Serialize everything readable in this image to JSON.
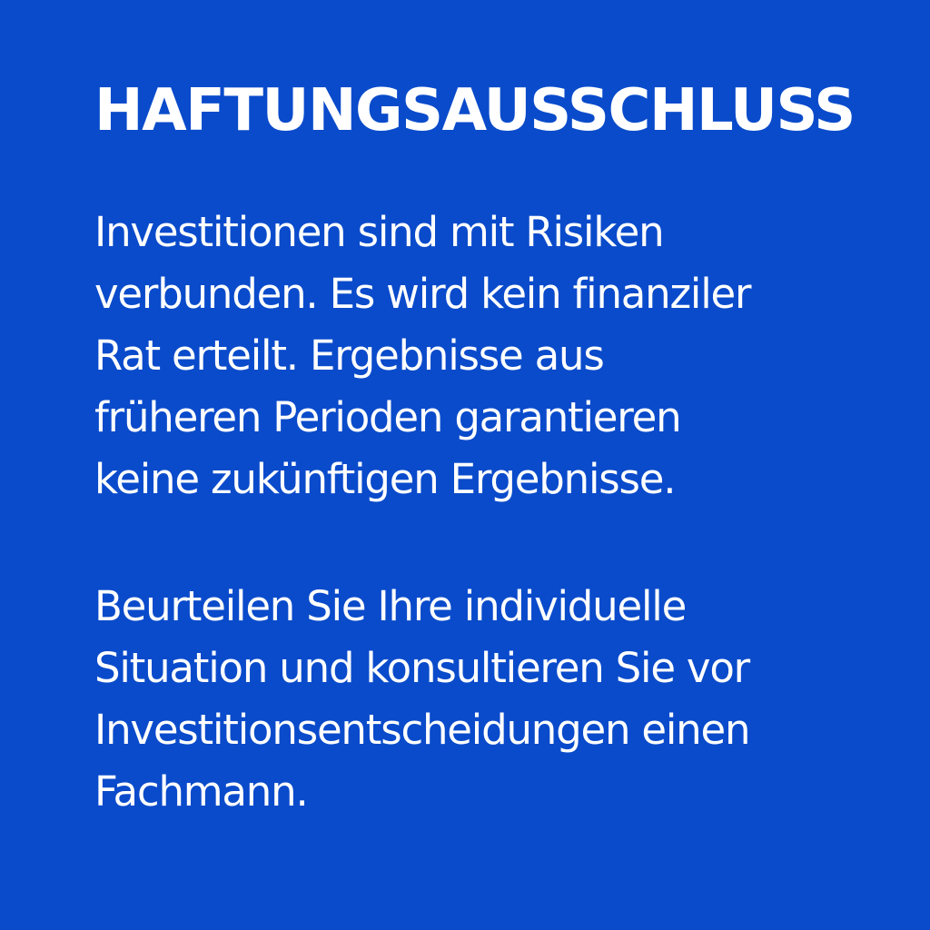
{
  "background_color": "#0A4BCB",
  "text_color": "#FFFFFF",
  "title": "HAFTUNGSAUSSCHLUSS",
  "paragraphs": [
    {
      "lines": [
        "Investitionen sind mit Risiken",
        "verbunden. Es wird kein finanziler",
        "Rat erteilt. Ergebnisse aus",
        "früheren Perioden garantieren",
        "keine zukünftigen Ergebnisse."
      ]
    },
    {
      "lines": [
        "Beurteilen Sie Ihre individuelle",
        "Situation und konsultieren Sie vor",
        "Investitionsentscheidungen einen",
        "Fachmann."
      ]
    }
  ]
}
